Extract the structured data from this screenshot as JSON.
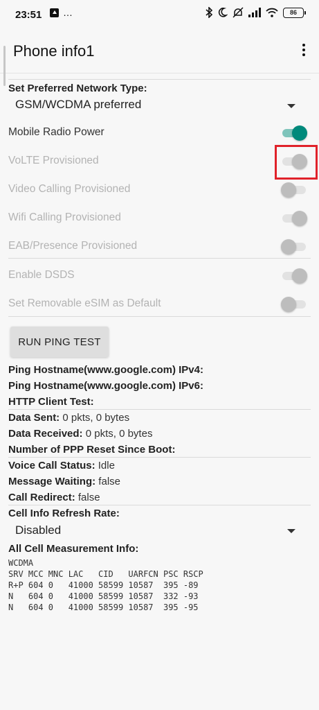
{
  "status_bar": {
    "time": "23:51",
    "more": "…",
    "battery": "86"
  },
  "app_bar": {
    "title": "Phone info1"
  },
  "network_type": {
    "label": "Set Preferred Network Type:",
    "value": "GSM/WCDMA preferred"
  },
  "switches": [
    {
      "label": "Mobile Radio Power",
      "checked": true,
      "enabled": true
    },
    {
      "label": "VoLTE Provisioned",
      "checked": true,
      "enabled": false
    },
    {
      "label": "Video Calling Provisioned",
      "checked": false,
      "enabled": false
    },
    {
      "label": "Wifi Calling Provisioned",
      "checked": true,
      "enabled": false
    },
    {
      "label": "EAB/Presence Provisioned",
      "checked": false,
      "enabled": false
    },
    {
      "label": "Enable DSDS",
      "checked": true,
      "enabled": false
    },
    {
      "label": "Set Removable eSIM as Default",
      "checked": false,
      "enabled": false
    }
  ],
  "ping_button": "RUN PING TEST",
  "info": {
    "ping_ipv4": "Ping Hostname(www.google.com) IPv4:",
    "ping_ipv6": "Ping Hostname(www.google.com) IPv6:",
    "http_test": "HTTP Client Test:",
    "data_sent_label": "Data Sent:",
    "data_sent_value": " 0 pkts, 0 bytes",
    "data_received_label": "Data Received:",
    "data_received_value": " 0 pkts, 0 bytes",
    "ppp_reset": "Number of PPP Reset Since Boot:",
    "voice_call_label": "Voice Call Status:",
    "voice_call_value": " Idle",
    "message_waiting_label": "Message Waiting:",
    "message_waiting_value": " false",
    "call_redirect_label": "Call Redirect:",
    "call_redirect_value": " false"
  },
  "refresh_rate": {
    "label": "Cell Info Refresh Rate:",
    "value": "Disabled"
  },
  "cell_measurement": {
    "label": "All Cell Measurement Info:",
    "rat": "WCDMA",
    "header": "SRV MCC MNC LAC   CID   UARFCN PSC RSCP",
    "rows": [
      "R+P 604 0   41000 58599 10587  395 -89",
      "N   604 0   41000 58599 10587  332 -93",
      "N   604 0   41000 58599 10587  395 -95"
    ]
  },
  "colors": {
    "accent": "#00897b",
    "highlight": "#e0222a"
  }
}
